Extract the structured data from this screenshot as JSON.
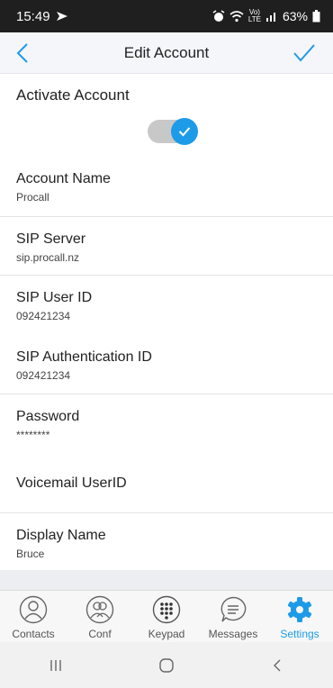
{
  "status_bar": {
    "time": "15:49",
    "network_label_top": "Vo)",
    "network_label_bottom": "LTE",
    "battery_percent": "63%"
  },
  "app_bar": {
    "title": "Edit Account",
    "back_icon": "chevron-left-icon",
    "done_icon": "checkmark-icon",
    "accent_color": "#1e9be8"
  },
  "activate": {
    "label": "Activate Account",
    "enabled": true
  },
  "fields": [
    {
      "label": "Account Name",
      "value": "Procall"
    },
    {
      "label": "SIP Server",
      "value": "sip.procall.nz"
    },
    {
      "label": "SIP User ID",
      "value": "092421234"
    },
    {
      "label": "SIP Authentication ID",
      "value": "092421234"
    },
    {
      "label": "Password",
      "value": "********"
    },
    {
      "label": "Voicemail UserID",
      "value": ""
    },
    {
      "label": "Display Name",
      "value": "Bruce"
    }
  ],
  "tabs": [
    {
      "label": "Contacts",
      "icon": "contacts-icon",
      "active": false
    },
    {
      "label": "Conf",
      "icon": "conference-icon",
      "active": false
    },
    {
      "label": "Keypad",
      "icon": "keypad-icon",
      "active": false
    },
    {
      "label": "Messages",
      "icon": "messages-icon",
      "active": false
    },
    {
      "label": "Settings",
      "icon": "gear-icon",
      "active": true
    }
  ],
  "nav_bar": {
    "recents_icon": "recents-icon",
    "home_icon": "home-icon",
    "back_icon": "back-icon"
  }
}
